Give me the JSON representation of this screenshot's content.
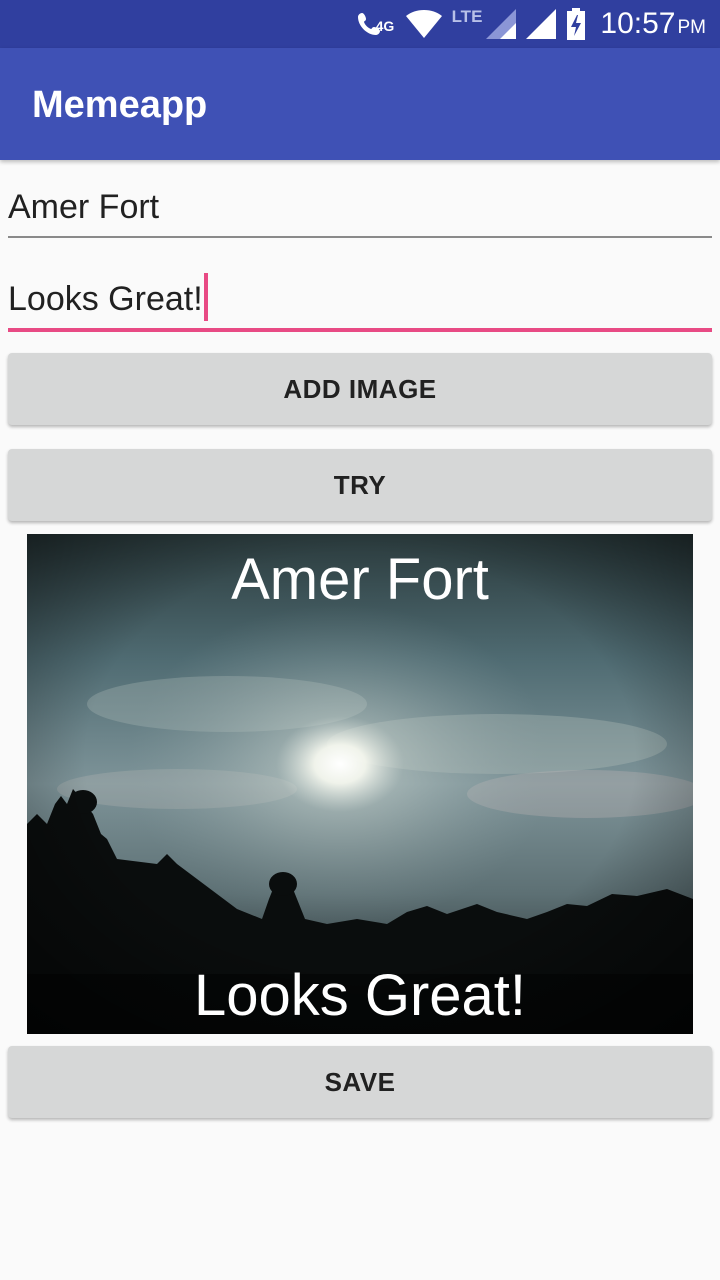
{
  "status_bar": {
    "network_4g": "4G",
    "network_lte": "LTE",
    "time": "10:57",
    "ampm": "PM",
    "icons": [
      "call-wifi-icon",
      "wifi-icon",
      "signal-icon",
      "signal-icon",
      "battery-charging-icon"
    ]
  },
  "app_bar": {
    "title": "Memeapp"
  },
  "form": {
    "top_text_value": "Amer Fort",
    "bottom_text_value": "Looks Great!"
  },
  "buttons": {
    "add_image": "ADD IMAGE",
    "try": "TRY",
    "save": "SAVE"
  },
  "meme": {
    "top_text": "Amer Fort",
    "bottom_text": "Looks Great!"
  },
  "colors": {
    "status_bar": "#303f9f",
    "app_bar": "#3f51b5",
    "accent": "#e84a84",
    "button": "#d6d7d7"
  }
}
